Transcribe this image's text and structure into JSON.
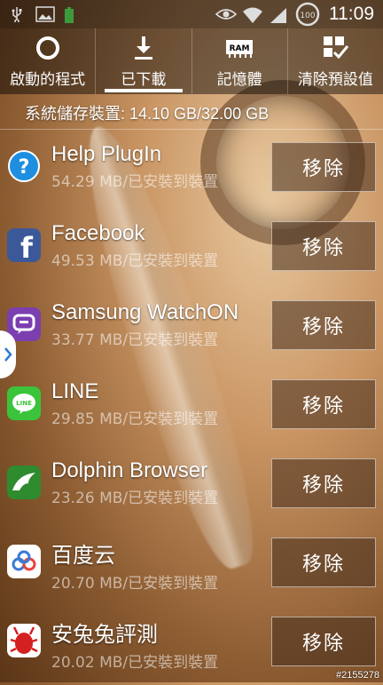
{
  "status_bar": {
    "time": "11:09",
    "left_icons": [
      "usb-icon",
      "image-icon",
      "battery-saver-icon"
    ],
    "right_icons": [
      "eye-icon",
      "wifi-icon",
      "signal-icon",
      "battery-100-icon"
    ],
    "battery_label": "100"
  },
  "tabs": [
    {
      "label": "啟動的程式",
      "icon": "running-apps-icon",
      "active": false
    },
    {
      "label": "已下載",
      "icon": "download-icon",
      "active": true
    },
    {
      "label": "記憶體",
      "icon": "ram-icon",
      "icon_text": "RAM",
      "active": false
    },
    {
      "label": "清除預設值",
      "icon": "clear-defaults-icon",
      "active": false
    }
  ],
  "storage": {
    "text": "系統儲存裝置: 14.10 GB/32.00 GB"
  },
  "apps": [
    {
      "name": "Help PlugIn",
      "meta": "54.29 MB/已安裝到裝置",
      "icon": "help-plugin-icon",
      "button": "移除"
    },
    {
      "name": "Facebook",
      "meta": "49.53 MB/已安裝到裝置",
      "icon": "facebook-icon",
      "button": "移除"
    },
    {
      "name": "Samsung WatchON",
      "meta": "33.77 MB/已安裝到裝置",
      "icon": "watchon-icon",
      "button": "移除"
    },
    {
      "name": "LINE",
      "meta": "29.85 MB/已安裝到裝置",
      "icon": "line-icon",
      "button": "移除"
    },
    {
      "name": "Dolphin Browser",
      "meta": "23.26 MB/已安裝到裝置",
      "icon": "dolphin-icon",
      "button": "移除"
    },
    {
      "name": "百度云",
      "meta": "20.70 MB/已安裝到裝置",
      "icon": "baidu-cloud-icon",
      "button": "移除"
    },
    {
      "name": "安兔兔評測",
      "meta": "20.02 MB/已安裝到裝置",
      "icon": "antutu-icon",
      "button": "移除"
    }
  ],
  "watermark": "#2155278",
  "colors": {
    "help": "#1e8fe0",
    "facebook": "#3b5998",
    "watchon": "#7b3fb0",
    "line": "#3bc43b",
    "dolphin": "#2e8b2e",
    "baidu": "#3a7bd5",
    "antutu": "#d42020"
  }
}
